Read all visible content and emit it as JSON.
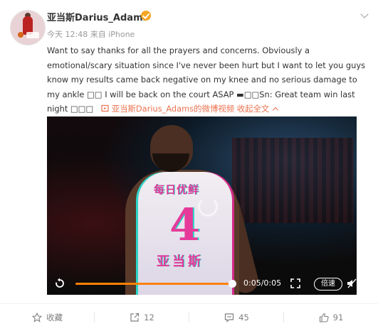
{
  "post": {
    "user_name": "亚当斯Darius_Adams",
    "meta": "今天 12:48 来自 iPhone",
    "text": "Want to say thanks for all the prayers and concerns. Obviously a emotional/scary situation since I've never been hurt but I want to let you guys know my results came back negative on my knee and no serious damage to my ankle □□ I will be back on the court ASAP ▬□□Sn: Great team win last night □□□",
    "video_link": "亚当斯Darius_Adams的微博视频",
    "collapse_label": "收起全文"
  },
  "video": {
    "sponsor_text": "每日优鲜",
    "jersey_number": "4",
    "jersey_name": "亚当斯",
    "time": "0:05/0:05",
    "speed_label": "倍速",
    "progress": 1.0
  },
  "actions": {
    "favorite_label": "收藏",
    "repost_count": "12",
    "comment_count": "45",
    "like_count": "91"
  },
  "colors": {
    "accent": "#eb7350",
    "progress": "#ff8200",
    "verified": "#f5a623"
  }
}
